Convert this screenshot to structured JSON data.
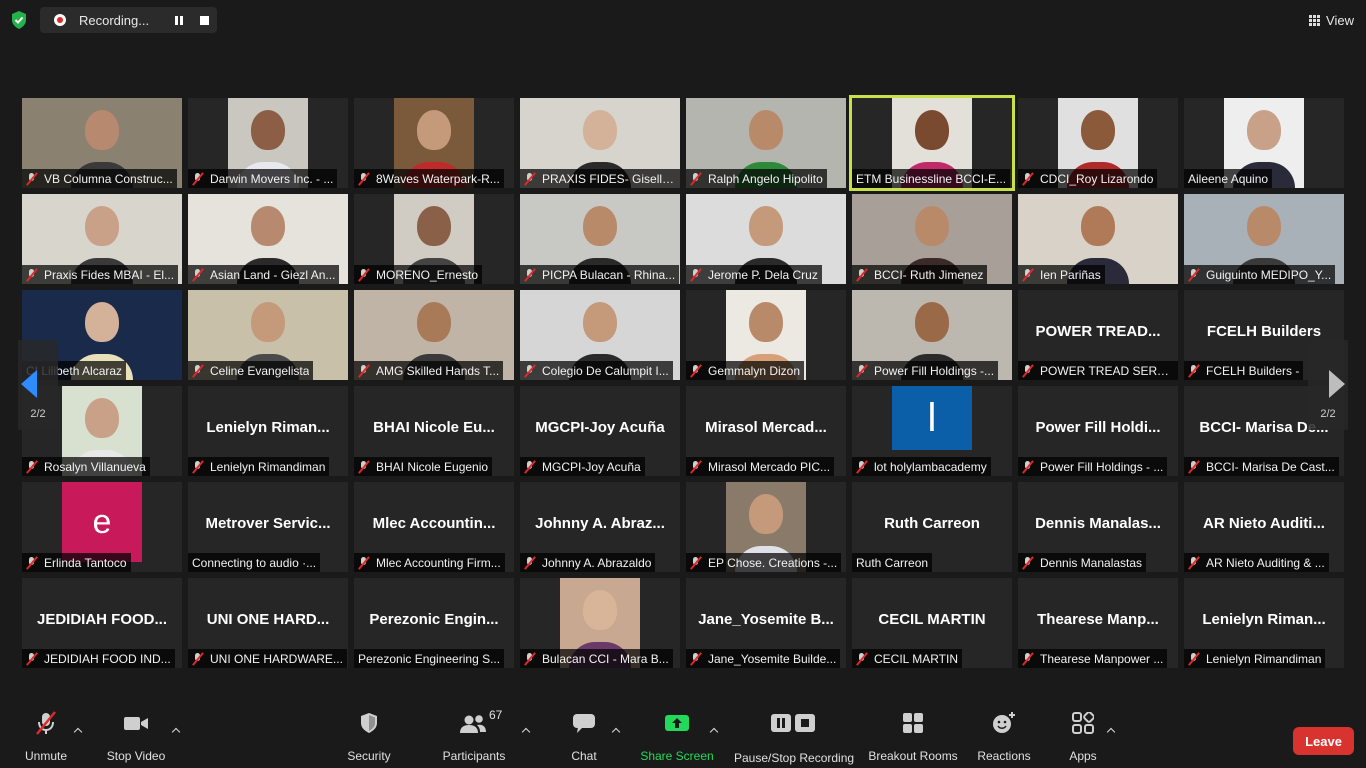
{
  "topbar": {
    "recording_label": "Recording...",
    "view_label": "View"
  },
  "pager": {
    "left_page": "2/2",
    "right_page": "2/2"
  },
  "tiles": [
    {
      "name": "VB Columna Construc...",
      "video": "photo",
      "bg": "#8a8170",
      "skin": "#b78a70",
      "shirt": "#3a3a3a",
      "mic": true
    },
    {
      "name": "Darwin Movers Inc. - ...",
      "video": "photo",
      "bg": "#c9c7c0",
      "skin": "#8b5e45",
      "shirt": "#e8e8ef",
      "mic": true,
      "narrow": true
    },
    {
      "name": "8Waves Waterpark-R...",
      "video": "photo",
      "bg": "#7a5a3a",
      "skin": "#c49a7a",
      "shirt": "#c02a2a",
      "mic": true,
      "narrow": true
    },
    {
      "name": "PRAXIS FIDES- Giselle...",
      "video": "photo",
      "bg": "#d6d4cc",
      "skin": "#d4b29a",
      "shirt": "#2a2a2a",
      "mic": true
    },
    {
      "name": "Ralph Angelo Hipolito",
      "video": "photo",
      "bg": "#b5b5b0",
      "skin": "#b98a6a",
      "shirt": "#2e8a3a",
      "mic": true
    },
    {
      "name": "ETM Businessline BCCI-E...",
      "video": "photo",
      "bg": "#e2e0d8",
      "skin": "#7a4a30",
      "shirt": "#c02a6a",
      "mic": false,
      "narrow": true,
      "active": true
    },
    {
      "name": "CDCI_Roy Lizarondo",
      "video": "photo",
      "bg": "#e0e0e0",
      "skin": "#8a5a3a",
      "shirt": "#b02a2a",
      "mic": true,
      "narrow": true
    },
    {
      "name": "Aileene Aquino",
      "video": "photo",
      "bg": "#eeeeee",
      "skin": "#c9a088",
      "shirt": "#2a2a3a",
      "mic": false,
      "narrow": true
    },
    {
      "name": "Praxis Fides MBAI - El...",
      "video": "photo",
      "bg": "#d8d6cc",
      "skin": "#c9a088",
      "shirt": "#3a3a3a",
      "mic": true
    },
    {
      "name": "Asian Land - Giezl An...",
      "video": "photo",
      "bg": "#e6e2dc",
      "skin": "#b78a70",
      "shirt": "#2a2a2a",
      "mic": true
    },
    {
      "name": "MORENO_Ernesto",
      "video": "photo",
      "bg": "#d0ccc4",
      "skin": "#8a6048",
      "shirt": "#444",
      "mic": true,
      "narrow": true
    },
    {
      "name": "PICPA Bulacan - Rhina...",
      "video": "photo",
      "bg": "#c8c8c4",
      "skin": "#b98a6a",
      "shirt": "#2a2a2a",
      "mic": true
    },
    {
      "name": "Jerome P. Dela Cruz",
      "video": "photo",
      "bg": "#dcdcdc",
      "skin": "#c49a7a",
      "shirt": "#2a2a2a",
      "mic": true
    },
    {
      "name": "BCCI- Ruth Jimenez",
      "video": "photo",
      "bg": "#a8a098",
      "skin": "#b98a6a",
      "shirt": "#3a2a2a",
      "mic": true
    },
    {
      "name": "Ien Pariñas",
      "video": "photo",
      "bg": "#d8d2c8",
      "skin": "#b07a58",
      "shirt": "#2a2a3a",
      "mic": true
    },
    {
      "name": "Guiguinto MEDIPO_Y...",
      "video": "photo",
      "bg": "#a8b0b8",
      "skin": "#b98a6a",
      "shirt": "#3a3a3a",
      "mic": true
    },
    {
      "name": "CI Lilibeth Alcaraz",
      "video": "photo",
      "bg": "#1a2a4a",
      "skin": "#d4b29a",
      "shirt": "#e8e0b8",
      "mic": false
    },
    {
      "name": "Celine Evangelista",
      "video": "photo",
      "bg": "#c8c0a8",
      "skin": "#c49a7a",
      "shirt": "#4a4a4a",
      "mic": true
    },
    {
      "name": "AMG Skilled Hands T...",
      "video": "photo",
      "bg": "#bfb4a6",
      "skin": "#a87a58",
      "shirt": "#3a3a3a",
      "mic": true
    },
    {
      "name": "Colegio De Calumpit I...",
      "video": "photo",
      "bg": "#d6d6d6",
      "skin": "#c49a7a",
      "shirt": "#2a2a2a",
      "mic": true
    },
    {
      "name": "Gemmalyn Dizon",
      "video": "photo",
      "bg": "#ece8e2",
      "skin": "#b98a6a",
      "shirt": "#d8a078",
      "mic": true,
      "narrow": true
    },
    {
      "name": "Power Fill Holdings -...",
      "video": "photo",
      "bg": "#bcb8b0",
      "skin": "#9a6a48",
      "shirt": "#2a2a2a",
      "mic": true
    },
    {
      "name": "POWER TREAD SERVI...",
      "big": "POWER TREAD...",
      "mic": true
    },
    {
      "name": "FCELH Builders -",
      "big": "FCELH Builders",
      "mic": true
    },
    {
      "name": "Rosalyn Villanueva",
      "video": "photo",
      "bg": "#d8e0d0",
      "skin": "#c9a088",
      "shirt": "#e8e8e8",
      "mic": true,
      "narrow": true
    },
    {
      "name": "Lenielyn Rimandiman",
      "big": "Lenielyn Riman...",
      "mic": true
    },
    {
      "name": "BHAI Nicole Eugenio",
      "big": "BHAI Nicole Eu...",
      "mic": true
    },
    {
      "name": "MGCPI-Joy Acuña",
      "big": "MGCPI-Joy Acuña",
      "mic": true
    },
    {
      "name": "Mirasol Mercado PIC...",
      "big": "Mirasol Mercad...",
      "mic": true
    },
    {
      "name": "lot holylambacademy",
      "avatar_block": "l",
      "mic": true
    },
    {
      "name": "Power Fill Holdings - ...",
      "big": "Power Fill Holdi...",
      "mic": true
    },
    {
      "name": "BCCI- Marisa De Cast...",
      "big": "BCCI- Marisa De...",
      "mic": true
    },
    {
      "name": "Erlinda Tantoco",
      "avatar_letter": "e",
      "mic": true
    },
    {
      "name": "Connecting to audio ·...",
      "big": "Metrover Servic...",
      "mic": false
    },
    {
      "name": "Mlec Accounting Firm...",
      "big": "Mlec Accountin...",
      "mic": true
    },
    {
      "name": "Johnny A. Abrazaldo",
      "big": "Johnny A. Abraz...",
      "mic": true
    },
    {
      "name": "EP Chose. Creations -...",
      "video": "photo",
      "bg": "#8a7a6a",
      "skin": "#c49a7a",
      "shirt": "#e0e0e8",
      "mic": true,
      "narrow": true
    },
    {
      "name": "Ruth Carreon",
      "big": "Ruth Carreon",
      "mic": false
    },
    {
      "name": "Dennis Manalastas",
      "big": "Dennis Manalas...",
      "mic": true
    },
    {
      "name": "AR Nieto Auditing & ...",
      "big": "AR Nieto Auditi...",
      "mic": true
    },
    {
      "name": "JEDIDIAH FOOD IND...",
      "big": "JEDIDIAH FOOD...",
      "mic": true
    },
    {
      "name": "UNI ONE HARDWARE...",
      "big": "UNI ONE HARD...",
      "mic": true
    },
    {
      "name": "Perezonic Engineering S...",
      "big": "Perezonic Engin...",
      "mic": false
    },
    {
      "name": "Bulacan CCI - Mara B...",
      "video": "photo",
      "bg": "#c8a890",
      "skin": "#d8b498",
      "shirt": "#6a3a6a",
      "mic": true,
      "narrow": true
    },
    {
      "name": "Jane_Yosemite Builde...",
      "big": "Jane_Yosemite B...",
      "mic": true
    },
    {
      "name": "CECIL MARTIN",
      "big": "CECIL MARTIN",
      "mic": true
    },
    {
      "name": "Thearese Manpower ...",
      "big": "Thearese Manp...",
      "mic": true
    },
    {
      "name": "Lenielyn Rimandiman",
      "big": "Lenielyn Riman...",
      "mic": true
    }
  ],
  "toolbar": {
    "unmute": "Unmute",
    "stop_video": "Stop Video",
    "security": "Security",
    "participants": "Participants",
    "participants_count": "67",
    "chat": "Chat",
    "share_screen": "Share Screen",
    "recording": "Pause/Stop Recording",
    "breakout": "Breakout Rooms",
    "reactions": "Reactions",
    "apps": "Apps",
    "leave": "Leave"
  },
  "colors": {
    "share_green": "#23d959",
    "leave_red": "#d8332e",
    "active_outline": "#c8e04a",
    "pager_blue": "#2d8cff"
  }
}
